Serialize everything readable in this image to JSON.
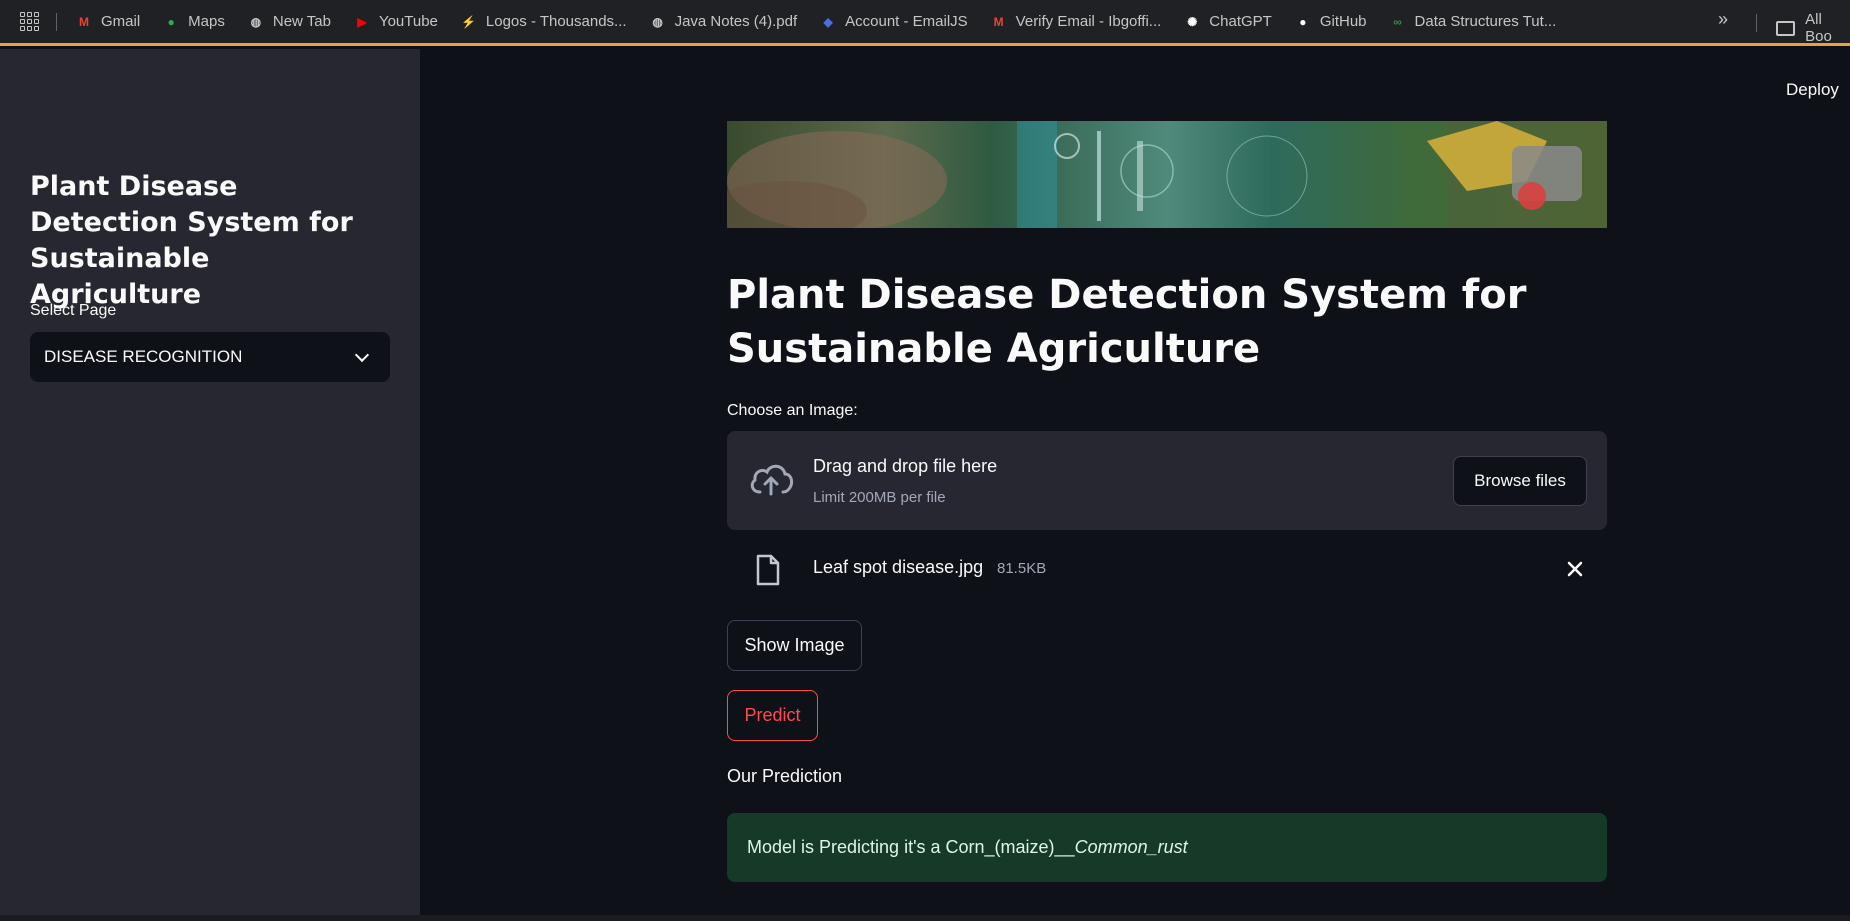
{
  "bookmarks": [
    {
      "label": "Gmail",
      "icon": "gmail-icon",
      "color": "#ea4335",
      "glyph": "M"
    },
    {
      "label": "Maps",
      "icon": "maps-icon",
      "color": "#34a853",
      "glyph": "●"
    },
    {
      "label": "New Tab",
      "icon": "globe-icon",
      "color": "#c4c7c5",
      "glyph": "◍"
    },
    {
      "label": "YouTube",
      "icon": "youtube-icon",
      "color": "#ff0000",
      "glyph": "▶"
    },
    {
      "label": "Logos - Thousands...",
      "icon": "logos-icon",
      "color": "#e53935",
      "glyph": "⚡"
    },
    {
      "label": "Java Notes (4).pdf",
      "icon": "globe-icon",
      "color": "#c4c7c5",
      "glyph": "◍"
    },
    {
      "label": "Account - EmailJS",
      "icon": "emailjs-icon",
      "color": "#4a6ee0",
      "glyph": "◆"
    },
    {
      "label": "Verify Email - Ibgoffi...",
      "icon": "gmail-icon",
      "color": "#ea4335",
      "glyph": "M"
    },
    {
      "label": "ChatGPT",
      "icon": "chatgpt-icon",
      "color": "#ffffff",
      "glyph": "✺"
    },
    {
      "label": "GitHub",
      "icon": "github-icon",
      "color": "#ffffff",
      "glyph": "●"
    },
    {
      "label": "Data Structures Tut...",
      "icon": "gfg-icon",
      "color": "#2f8d46",
      "glyph": "∞"
    }
  ],
  "more_bookmarks": "»",
  "all_bookmarks": "All Boo",
  "sidebar": {
    "title": "Plant Disease Detection System for Sustainable Agriculture",
    "select_label": "Select Page",
    "select_value": "DISEASE RECOGNITION"
  },
  "header": {
    "deploy_label": "Deploy"
  },
  "main": {
    "title": "Plant Disease Detection System for Sustainable Agriculture",
    "uploader_label": "Choose an Image:",
    "dropzone_main": "Drag and drop file here",
    "dropzone_sub": "Limit 200MB per file",
    "browse_label": "Browse files",
    "file_name": "Leaf spot disease.jpg",
    "file_size": "81.5KB",
    "show_image_label": "Show Image",
    "predict_label": "Predict",
    "prediction_heading": "Our Prediction",
    "prediction_prefix": "Model is Predicting it's a Corn_(maize)__",
    "prediction_italic": "Common_rust"
  },
  "colors": {
    "background": "#0e1117",
    "sidebar": "#262730",
    "accent": "#ff4b4b",
    "success_bg": "#173928"
  }
}
